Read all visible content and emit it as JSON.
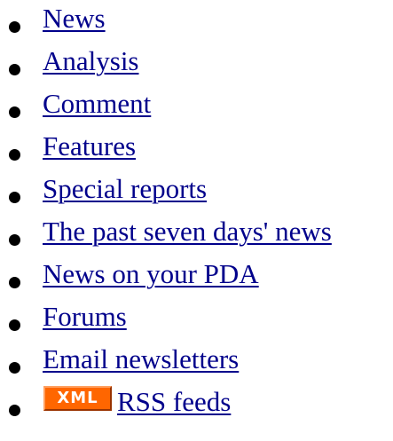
{
  "nav": {
    "items": [
      {
        "label": "News"
      },
      {
        "label": "Analysis"
      },
      {
        "label": "Comment"
      },
      {
        "label": "Features"
      },
      {
        "label": "Special reports"
      },
      {
        "label": "The past seven days' news"
      },
      {
        "label": "News on your PDA"
      },
      {
        "label": "Forums"
      },
      {
        "label": "Email newsletters"
      },
      {
        "label": "RSS feeds",
        "badge": "XML"
      }
    ]
  },
  "colors": {
    "link": "#00008b",
    "bullet": "#000000",
    "xml_badge_bg": "#ff6600",
    "xml_badge_text": "#ffffff"
  }
}
